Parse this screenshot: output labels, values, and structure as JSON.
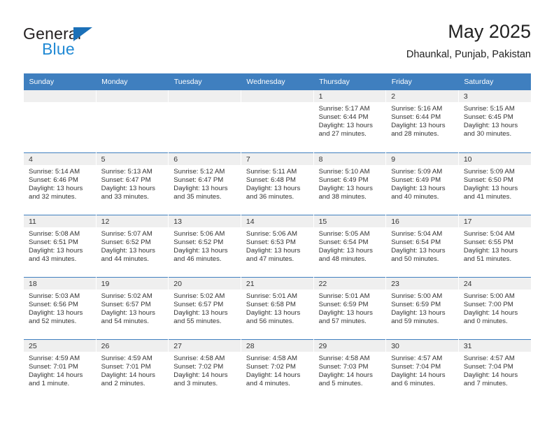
{
  "brand": {
    "name_part1": "General",
    "name_part2": "Blue",
    "color_dark": "#231f20",
    "color_blue": "#2089d4",
    "triangle_color": "#1b70b8"
  },
  "header": {
    "title": "May 2025",
    "subtitle": "Dhaunkal, Punjab, Pakistan"
  },
  "theme": {
    "header_row_bg": "#3f7fbf",
    "daynum_band_bg": "#efefef",
    "text_color": "#333333"
  },
  "weekdays": [
    "Sunday",
    "Monday",
    "Tuesday",
    "Wednesday",
    "Thursday",
    "Friday",
    "Saturday"
  ],
  "weeks": [
    [
      {
        "day": "",
        "empty": true,
        "sunrise": "",
        "sunset": "",
        "daylight_line1": "",
        "daylight_line2": ""
      },
      {
        "day": "",
        "empty": true,
        "sunrise": "",
        "sunset": "",
        "daylight_line1": "",
        "daylight_line2": ""
      },
      {
        "day": "",
        "empty": true,
        "sunrise": "",
        "sunset": "",
        "daylight_line1": "",
        "daylight_line2": ""
      },
      {
        "day": "",
        "empty": true,
        "sunrise": "",
        "sunset": "",
        "daylight_line1": "",
        "daylight_line2": ""
      },
      {
        "day": "1",
        "empty": false,
        "sunrise": "Sunrise: 5:17 AM",
        "sunset": "Sunset: 6:44 PM",
        "daylight_line1": "Daylight: 13 hours",
        "daylight_line2": "and 27 minutes."
      },
      {
        "day": "2",
        "empty": false,
        "sunrise": "Sunrise: 5:16 AM",
        "sunset": "Sunset: 6:44 PM",
        "daylight_line1": "Daylight: 13 hours",
        "daylight_line2": "and 28 minutes."
      },
      {
        "day": "3",
        "empty": false,
        "sunrise": "Sunrise: 5:15 AM",
        "sunset": "Sunset: 6:45 PM",
        "daylight_line1": "Daylight: 13 hours",
        "daylight_line2": "and 30 minutes."
      }
    ],
    [
      {
        "day": "4",
        "empty": false,
        "sunrise": "Sunrise: 5:14 AM",
        "sunset": "Sunset: 6:46 PM",
        "daylight_line1": "Daylight: 13 hours",
        "daylight_line2": "and 32 minutes."
      },
      {
        "day": "5",
        "empty": false,
        "sunrise": "Sunrise: 5:13 AM",
        "sunset": "Sunset: 6:47 PM",
        "daylight_line1": "Daylight: 13 hours",
        "daylight_line2": "and 33 minutes."
      },
      {
        "day": "6",
        "empty": false,
        "sunrise": "Sunrise: 5:12 AM",
        "sunset": "Sunset: 6:47 PM",
        "daylight_line1": "Daylight: 13 hours",
        "daylight_line2": "and 35 minutes."
      },
      {
        "day": "7",
        "empty": false,
        "sunrise": "Sunrise: 5:11 AM",
        "sunset": "Sunset: 6:48 PM",
        "daylight_line1": "Daylight: 13 hours",
        "daylight_line2": "and 36 minutes."
      },
      {
        "day": "8",
        "empty": false,
        "sunrise": "Sunrise: 5:10 AM",
        "sunset": "Sunset: 6:49 PM",
        "daylight_line1": "Daylight: 13 hours",
        "daylight_line2": "and 38 minutes."
      },
      {
        "day": "9",
        "empty": false,
        "sunrise": "Sunrise: 5:09 AM",
        "sunset": "Sunset: 6:49 PM",
        "daylight_line1": "Daylight: 13 hours",
        "daylight_line2": "and 40 minutes."
      },
      {
        "day": "10",
        "empty": false,
        "sunrise": "Sunrise: 5:09 AM",
        "sunset": "Sunset: 6:50 PM",
        "daylight_line1": "Daylight: 13 hours",
        "daylight_line2": "and 41 minutes."
      }
    ],
    [
      {
        "day": "11",
        "empty": false,
        "sunrise": "Sunrise: 5:08 AM",
        "sunset": "Sunset: 6:51 PM",
        "daylight_line1": "Daylight: 13 hours",
        "daylight_line2": "and 43 minutes."
      },
      {
        "day": "12",
        "empty": false,
        "sunrise": "Sunrise: 5:07 AM",
        "sunset": "Sunset: 6:52 PM",
        "daylight_line1": "Daylight: 13 hours",
        "daylight_line2": "and 44 minutes."
      },
      {
        "day": "13",
        "empty": false,
        "sunrise": "Sunrise: 5:06 AM",
        "sunset": "Sunset: 6:52 PM",
        "daylight_line1": "Daylight: 13 hours",
        "daylight_line2": "and 46 minutes."
      },
      {
        "day": "14",
        "empty": false,
        "sunrise": "Sunrise: 5:06 AM",
        "sunset": "Sunset: 6:53 PM",
        "daylight_line1": "Daylight: 13 hours",
        "daylight_line2": "and 47 minutes."
      },
      {
        "day": "15",
        "empty": false,
        "sunrise": "Sunrise: 5:05 AM",
        "sunset": "Sunset: 6:54 PM",
        "daylight_line1": "Daylight: 13 hours",
        "daylight_line2": "and 48 minutes."
      },
      {
        "day": "16",
        "empty": false,
        "sunrise": "Sunrise: 5:04 AM",
        "sunset": "Sunset: 6:54 PM",
        "daylight_line1": "Daylight: 13 hours",
        "daylight_line2": "and 50 minutes."
      },
      {
        "day": "17",
        "empty": false,
        "sunrise": "Sunrise: 5:04 AM",
        "sunset": "Sunset: 6:55 PM",
        "daylight_line1": "Daylight: 13 hours",
        "daylight_line2": "and 51 minutes."
      }
    ],
    [
      {
        "day": "18",
        "empty": false,
        "sunrise": "Sunrise: 5:03 AM",
        "sunset": "Sunset: 6:56 PM",
        "daylight_line1": "Daylight: 13 hours",
        "daylight_line2": "and 52 minutes."
      },
      {
        "day": "19",
        "empty": false,
        "sunrise": "Sunrise: 5:02 AM",
        "sunset": "Sunset: 6:57 PM",
        "daylight_line1": "Daylight: 13 hours",
        "daylight_line2": "and 54 minutes."
      },
      {
        "day": "20",
        "empty": false,
        "sunrise": "Sunrise: 5:02 AM",
        "sunset": "Sunset: 6:57 PM",
        "daylight_line1": "Daylight: 13 hours",
        "daylight_line2": "and 55 minutes."
      },
      {
        "day": "21",
        "empty": false,
        "sunrise": "Sunrise: 5:01 AM",
        "sunset": "Sunset: 6:58 PM",
        "daylight_line1": "Daylight: 13 hours",
        "daylight_line2": "and 56 minutes."
      },
      {
        "day": "22",
        "empty": false,
        "sunrise": "Sunrise: 5:01 AM",
        "sunset": "Sunset: 6:59 PM",
        "daylight_line1": "Daylight: 13 hours",
        "daylight_line2": "and 57 minutes."
      },
      {
        "day": "23",
        "empty": false,
        "sunrise": "Sunrise: 5:00 AM",
        "sunset": "Sunset: 6:59 PM",
        "daylight_line1": "Daylight: 13 hours",
        "daylight_line2": "and 59 minutes."
      },
      {
        "day": "24",
        "empty": false,
        "sunrise": "Sunrise: 5:00 AM",
        "sunset": "Sunset: 7:00 PM",
        "daylight_line1": "Daylight: 14 hours",
        "daylight_line2": "and 0 minutes."
      }
    ],
    [
      {
        "day": "25",
        "empty": false,
        "sunrise": "Sunrise: 4:59 AM",
        "sunset": "Sunset: 7:01 PM",
        "daylight_line1": "Daylight: 14 hours",
        "daylight_line2": "and 1 minute."
      },
      {
        "day": "26",
        "empty": false,
        "sunrise": "Sunrise: 4:59 AM",
        "sunset": "Sunset: 7:01 PM",
        "daylight_line1": "Daylight: 14 hours",
        "daylight_line2": "and 2 minutes."
      },
      {
        "day": "27",
        "empty": false,
        "sunrise": "Sunrise: 4:58 AM",
        "sunset": "Sunset: 7:02 PM",
        "daylight_line1": "Daylight: 14 hours",
        "daylight_line2": "and 3 minutes."
      },
      {
        "day": "28",
        "empty": false,
        "sunrise": "Sunrise: 4:58 AM",
        "sunset": "Sunset: 7:02 PM",
        "daylight_line1": "Daylight: 14 hours",
        "daylight_line2": "and 4 minutes."
      },
      {
        "day": "29",
        "empty": false,
        "sunrise": "Sunrise: 4:58 AM",
        "sunset": "Sunset: 7:03 PM",
        "daylight_line1": "Daylight: 14 hours",
        "daylight_line2": "and 5 minutes."
      },
      {
        "day": "30",
        "empty": false,
        "sunrise": "Sunrise: 4:57 AM",
        "sunset": "Sunset: 7:04 PM",
        "daylight_line1": "Daylight: 14 hours",
        "daylight_line2": "and 6 minutes."
      },
      {
        "day": "31",
        "empty": false,
        "sunrise": "Sunrise: 4:57 AM",
        "sunset": "Sunset: 7:04 PM",
        "daylight_line1": "Daylight: 14 hours",
        "daylight_line2": "and 7 minutes."
      }
    ]
  ]
}
